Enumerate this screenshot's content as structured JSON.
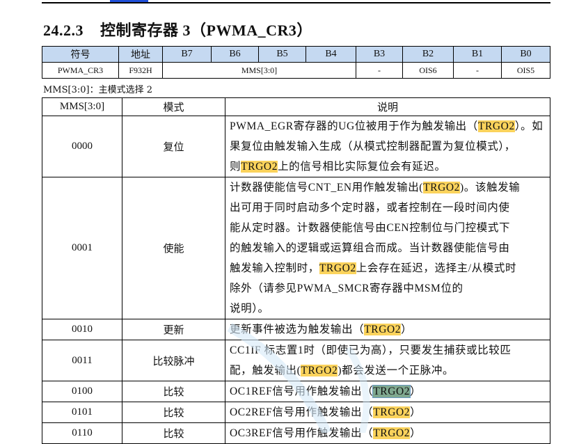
{
  "heading": {
    "number": "24.2.3",
    "title": "控制寄存器 3（PWMA_CR3）"
  },
  "register_table": {
    "headers": [
      "符号",
      "地址",
      "B7",
      "B6",
      "B5",
      "B4",
      "B3",
      "B2",
      "B1",
      "B0"
    ],
    "row": {
      "symbol": "PWMA_CR3",
      "address": "F932H",
      "mms": "MMS[3:0]",
      "b3": "-",
      "b2": "OIS6",
      "b1": "-",
      "b0": "OIS5"
    }
  },
  "note": "MMS[3:0]：主模式选择 2",
  "mode_table": {
    "headers": [
      "MMS[3:0]",
      "模式",
      "说明"
    ],
    "rows": [
      {
        "code": "0000",
        "mode": "复位",
        "lines": [
          [
            [
              "PWMA_EGR寄存器的UG位被用于作为触发输出（",
              0
            ],
            [
              "TRGO2",
              1
            ],
            [
              "）。如",
              0
            ]
          ],
          [
            [
              "果复位由触发输入生成（从模式控制器配置为复位模式），",
              0
            ]
          ],
          [
            [
              "则",
              0
            ],
            [
              "TRGO2",
              1
            ],
            [
              "上的信号相比实际复位会有延迟。",
              0
            ]
          ]
        ]
      },
      {
        "code": "0001",
        "mode": "使能",
        "lines": [
          [
            [
              "计数器使能信号CNT_EN用作触发输出(",
              0
            ],
            [
              "TRGO2",
              1
            ],
            [
              ")。该触发输",
              0
            ]
          ],
          [
            [
              "出可用于同时启动多个定时器，或者控制在一段时间内使",
              0
            ]
          ],
          [
            [
              "能从定时器。计数器使能信号由CEN控制位与门控模式下",
              0
            ]
          ],
          [
            [
              "的触发输入的逻辑或运算组合而成。当计数器使能信号由",
              0
            ]
          ],
          [
            [
              "触发输入控制时，",
              0
            ],
            [
              "TRGO2",
              1
            ],
            [
              "上会存在延迟，选择主/从模式时",
              0
            ]
          ],
          [
            [
              "除外（请参见PWMA_SMCR寄存器中MSM位的",
              0
            ]
          ],
          [
            [
              "说明）。",
              0
            ]
          ]
        ]
      },
      {
        "code": "0010",
        "mode": "更新",
        "lines": [
          [
            [
              "更新事件被选为触发输出（",
              0
            ],
            [
              "TRGO2",
              1
            ],
            [
              "）",
              0
            ]
          ]
        ]
      },
      {
        "code": "0011",
        "mode": "比较脉冲",
        "lines": [
          [
            [
              "CC1IF 标志置1时（即使已为高），只要发生捕获或比较匹",
              0
            ]
          ],
          [
            [
              "配，触发输出(",
              0
            ],
            [
              "TRGO2",
              1
            ],
            [
              ")都会发送一个正脉冲。",
              0
            ]
          ]
        ]
      },
      {
        "code": "0100",
        "mode": "比较",
        "lines": [
          [
            [
              "OC1REF信号用作触发输出（",
              0
            ],
            [
              "TRGO2",
              2
            ],
            [
              "）",
              0
            ]
          ]
        ]
      },
      {
        "code": "0101",
        "mode": "比较",
        "lines": [
          [
            [
              "OC2REF信号用作触发输出（",
              0
            ],
            [
              "TRGO2",
              1
            ],
            [
              "）",
              0
            ]
          ]
        ]
      },
      {
        "code": "0110",
        "mode": "比较",
        "lines": [
          [
            [
              "OC3REF信号用作触发输出（",
              0
            ],
            [
              "TRGO2",
              1
            ],
            [
              "）",
              0
            ]
          ]
        ]
      }
    ]
  },
  "colors": {
    "header_bg": "#c5d9f1",
    "highlight": "#fbd35c",
    "selection": "#7fa88f"
  }
}
